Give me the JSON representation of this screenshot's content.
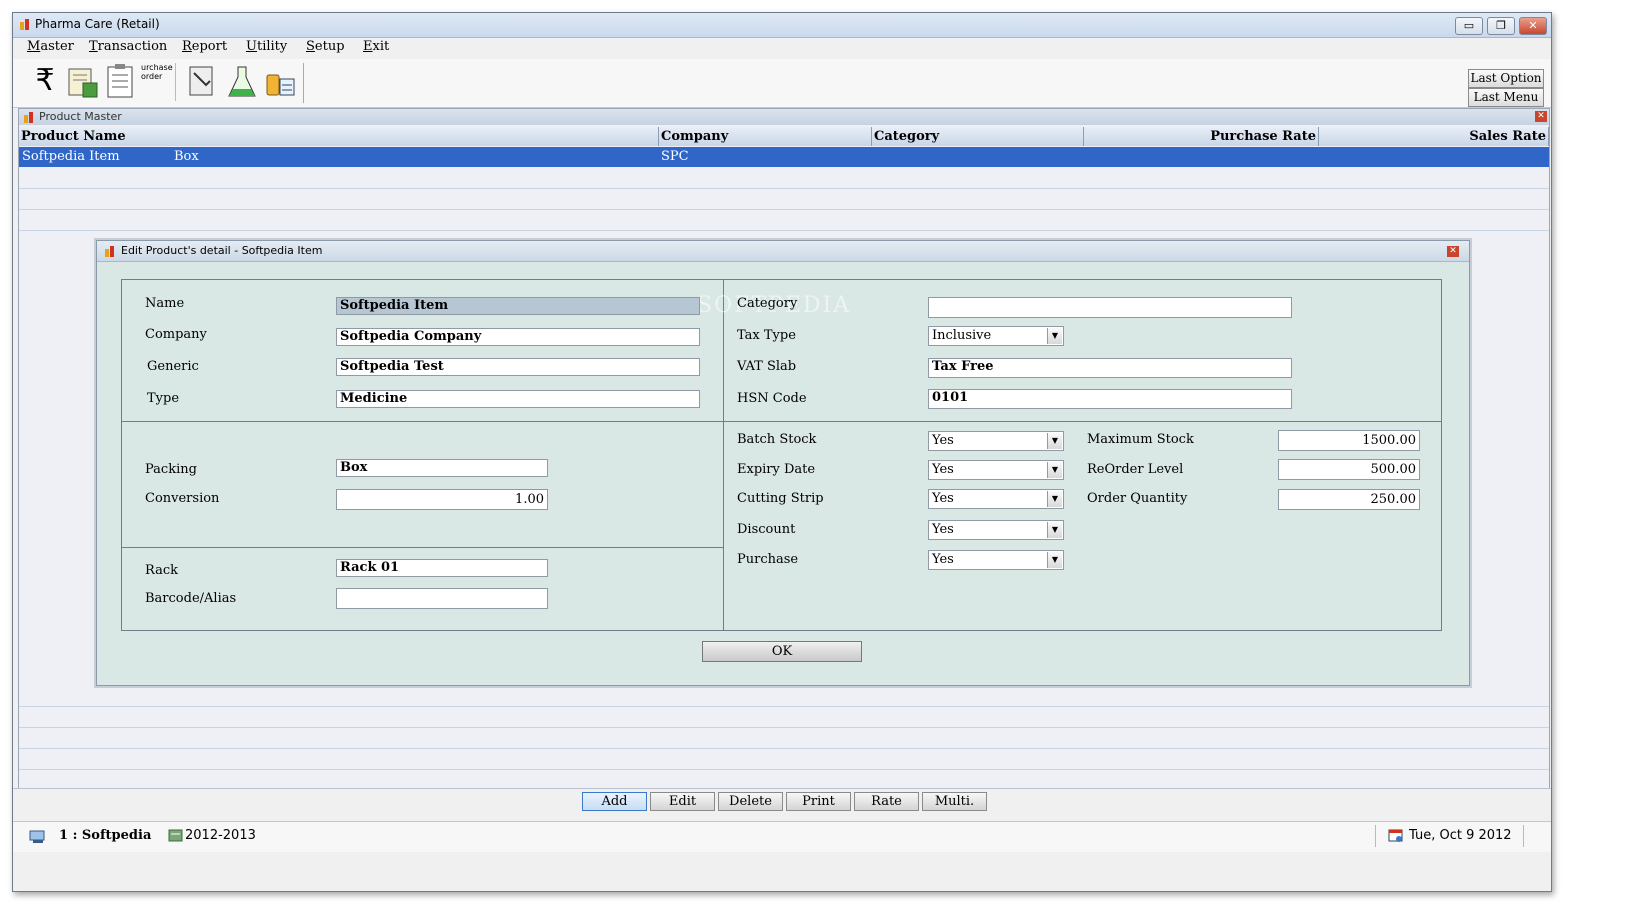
{
  "app": {
    "title": "Pharma Care (Retail)"
  },
  "window_buttons": {
    "minimize": "▭",
    "restore": "❐",
    "close": "✕"
  },
  "menu": [
    "Master",
    "Transaction",
    "Report",
    "Utility",
    "Setup",
    "Exit"
  ],
  "toolbar": {
    "icons": [
      "rupee-icon",
      "invoice-icon",
      "clipboard-icon",
      "purchase-order-icon",
      "ledger-icon",
      "flask-icon",
      "medicine-icon"
    ],
    "purchase_text": "urchase\norder",
    "last_option": "Last Option",
    "last_menu": "Last Menu"
  },
  "product_master": {
    "title": "Product Master",
    "columns": [
      "Product Name",
      "Company",
      "Category",
      "Purchase Rate",
      "Sales Rate"
    ],
    "rows": [
      {
        "name": "Softpedia Item",
        "pack": "Box",
        "company": "SPC"
      }
    ]
  },
  "dialog": {
    "title": "Edit Product's detail - Softpedia Item",
    "name": {
      "label": "Name",
      "value": "Softpedia Item"
    },
    "company": {
      "label": "Company",
      "value": "Softpedia Company"
    },
    "generic": {
      "label": "Generic",
      "value": "Softpedia Test"
    },
    "type": {
      "label": "Type",
      "value": "Medicine"
    },
    "category": {
      "label": "Category",
      "value": ""
    },
    "tax_type": {
      "label": "Tax Type",
      "value": "Inclusive"
    },
    "vat_slab": {
      "label": "VAT Slab",
      "value": "Tax Free"
    },
    "hsn_code": {
      "label": "HSN Code",
      "value": "0101"
    },
    "packing": {
      "label": "Packing",
      "value": "Box"
    },
    "conversion": {
      "label": "Conversion",
      "value": "1.00"
    },
    "rack": {
      "label": "Rack",
      "value": "Rack 01"
    },
    "barcode": {
      "label": "Barcode/Alias",
      "value": ""
    },
    "batch_stock": {
      "label": "Batch Stock",
      "value": "Yes"
    },
    "expiry_date": {
      "label": "Expiry Date",
      "value": "Yes"
    },
    "cutting_strip": {
      "label": "Cutting Strip",
      "value": "Yes"
    },
    "discount": {
      "label": "Discount",
      "value": "Yes"
    },
    "purchase": {
      "label": "Purchase",
      "value": "Yes"
    },
    "max_stock": {
      "label": "Maximum Stock",
      "value": "1500.00"
    },
    "reorder_level": {
      "label": "ReOrder Level",
      "value": "500.00"
    },
    "order_qty": {
      "label": "Order Quantity",
      "value": "250.00"
    },
    "ok": "OK",
    "watermark": "SOFTPEDIA"
  },
  "actions": [
    "Add",
    "Edit",
    "Delete",
    "Print",
    "Rate",
    "Multi."
  ],
  "status": {
    "user": "1 : Softpedia",
    "year": "2012-2013",
    "date": "Tue, Oct 9 2012"
  },
  "colors": {
    "selection": "#2f66c8",
    "dialog_bg": "#d9e7e5",
    "grid_bg": "#eef0f6"
  }
}
